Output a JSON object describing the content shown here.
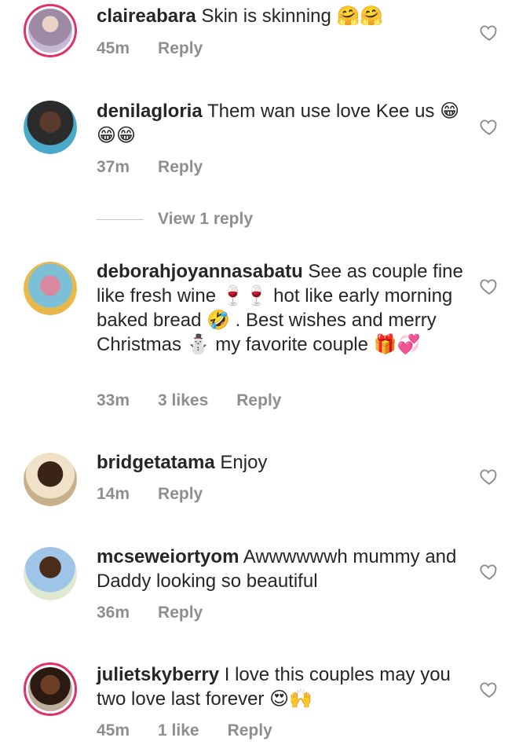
{
  "comments": [
    {
      "username": "claireabara",
      "text": "Skin is skinning 🤗🤗",
      "time": "45m",
      "likes": "",
      "reply_label": "Reply"
    },
    {
      "username": "denilagloria",
      "text": "Them wan use love Kee us 😁😁😁",
      "time": "37m",
      "likes": "",
      "reply_label": "Reply"
    },
    {
      "username": "deborahjoyannasabatu",
      "text": "See as couple fine like fresh wine 🍷🍷 hot like early morning baked bread 🤣 . Best wishes and merry Christmas ⛄ my favorite couple 🎁💞",
      "time": "33m",
      "likes": "3 likes",
      "reply_label": "Reply"
    },
    {
      "username": "bridgetatama",
      "text": "Enjoy",
      "time": "14m",
      "likes": "",
      "reply_label": "Reply"
    },
    {
      "username": "mcseweiortyom",
      "text": "Awwwwwwh mummy and Daddy looking so beautiful",
      "time": "36m",
      "likes": "",
      "reply_label": "Reply"
    },
    {
      "username": "julietskyberry",
      "text": "I love this couples may you two love last forever 😍🙌",
      "time": "45m",
      "likes": "1 like",
      "reply_label": "Reply"
    }
  ],
  "view_replies_label": "View 1 reply",
  "icons": {
    "like": "heart-outline-icon"
  },
  "colors": {
    "story_ring": "#e1306c",
    "meta_text": "#8e8e8e",
    "body_text": "#262626"
  }
}
